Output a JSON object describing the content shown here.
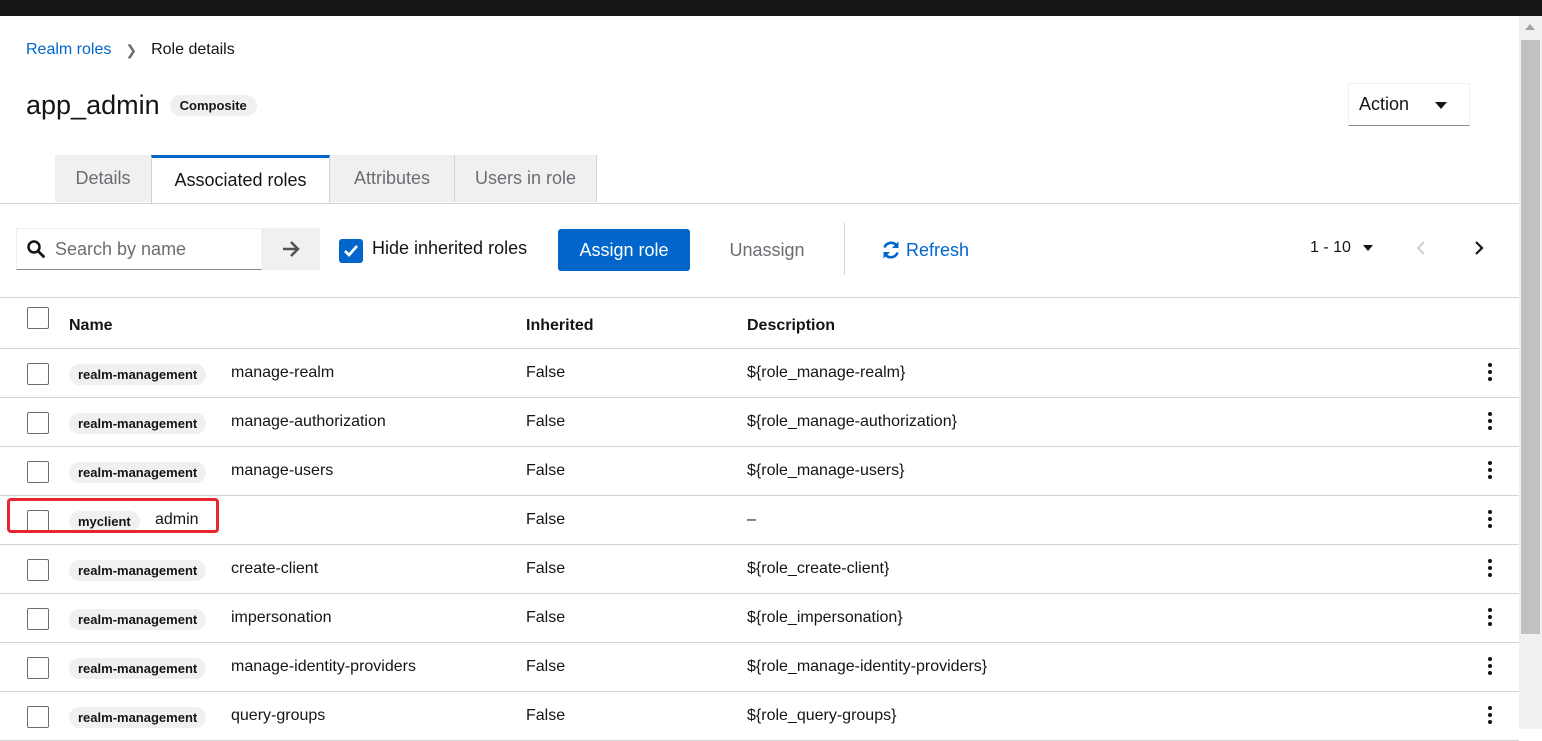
{
  "breadcrumb": {
    "parent": "Realm roles",
    "current": "Role details"
  },
  "header": {
    "title": "app_admin",
    "badge": "Composite",
    "action_label": "Action"
  },
  "tabs": [
    {
      "label": "Details"
    },
    {
      "label": "Associated roles"
    },
    {
      "label": "Attributes"
    },
    {
      "label": "Users in role"
    }
  ],
  "toolbar": {
    "search_placeholder": "Search by name",
    "hide_inherited_label": "Hide inherited roles",
    "hide_inherited_checked": true,
    "assign_label": "Assign role",
    "unassign_label": "Unassign",
    "refresh_label": "Refresh",
    "pagination": "1 - 10"
  },
  "table": {
    "columns": {
      "name": "Name",
      "inherited": "Inherited",
      "description": "Description"
    },
    "rows": [
      {
        "client": "realm-management",
        "name": "manage-realm",
        "inherited": "False",
        "description": "${role_manage-realm}"
      },
      {
        "client": "realm-management",
        "name": "manage-authorization",
        "inherited": "False",
        "description": "${role_manage-authorization}"
      },
      {
        "client": "realm-management",
        "name": "manage-users",
        "inherited": "False",
        "description": "${role_manage-users}"
      },
      {
        "client": "myclient",
        "name": "admin",
        "inherited": "False",
        "description": "–"
      },
      {
        "client": "realm-management",
        "name": "create-client",
        "inherited": "False",
        "description": "${role_create-client}"
      },
      {
        "client": "realm-management",
        "name": "impersonation",
        "inherited": "False",
        "description": "${role_impersonation}"
      },
      {
        "client": "realm-management",
        "name": "manage-identity-providers",
        "inherited": "False",
        "description": "${role_manage-identity-providers}"
      },
      {
        "client": "realm-management",
        "name": "query-groups",
        "inherited": "False",
        "description": "${role_query-groups}"
      }
    ]
  },
  "colors": {
    "primary": "#0066cc",
    "highlight": "#e8242f",
    "badge_bg": "#f0f0f0"
  },
  "icons": [
    "search-icon",
    "arrow-right-icon",
    "check-icon",
    "refresh-icon",
    "caret-down-icon",
    "chevron-left-icon",
    "chevron-right-icon",
    "kebab-icon"
  ]
}
